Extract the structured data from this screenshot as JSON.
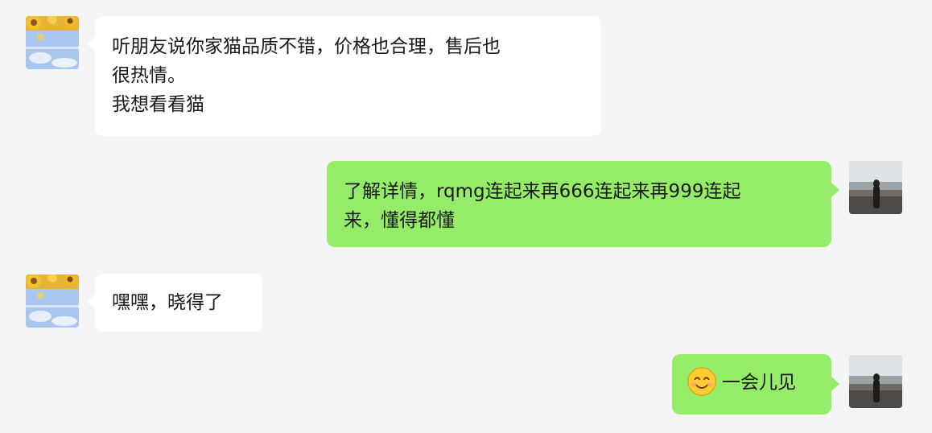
{
  "chat": {
    "messages": [
      {
        "from": "contact",
        "lines": [
          "听朋友说你家猫品质不错，价格也合理，售后也",
          "很热情。",
          "我想看看猫"
        ]
      },
      {
        "from": "me",
        "lines": [
          "了解详情，rqmg连起来再666连起来再999连起",
          "来，懂得都懂"
        ]
      },
      {
        "from": "contact",
        "lines": [
          "嘿嘿，晓得了"
        ]
      },
      {
        "from": "me",
        "emoji": "smiling-face-emoji",
        "lines": [
          "一会儿见"
        ]
      }
    ]
  },
  "colors": {
    "background": "#f5f5f5",
    "incoming_bubble": "#ffffff",
    "outgoing_bubble": "#95ec69"
  },
  "icons": {
    "contact_avatar": "sunflower-sky-avatar",
    "my_avatar": "seaside-person-avatar",
    "emoji": "smiling-face-emoji"
  }
}
